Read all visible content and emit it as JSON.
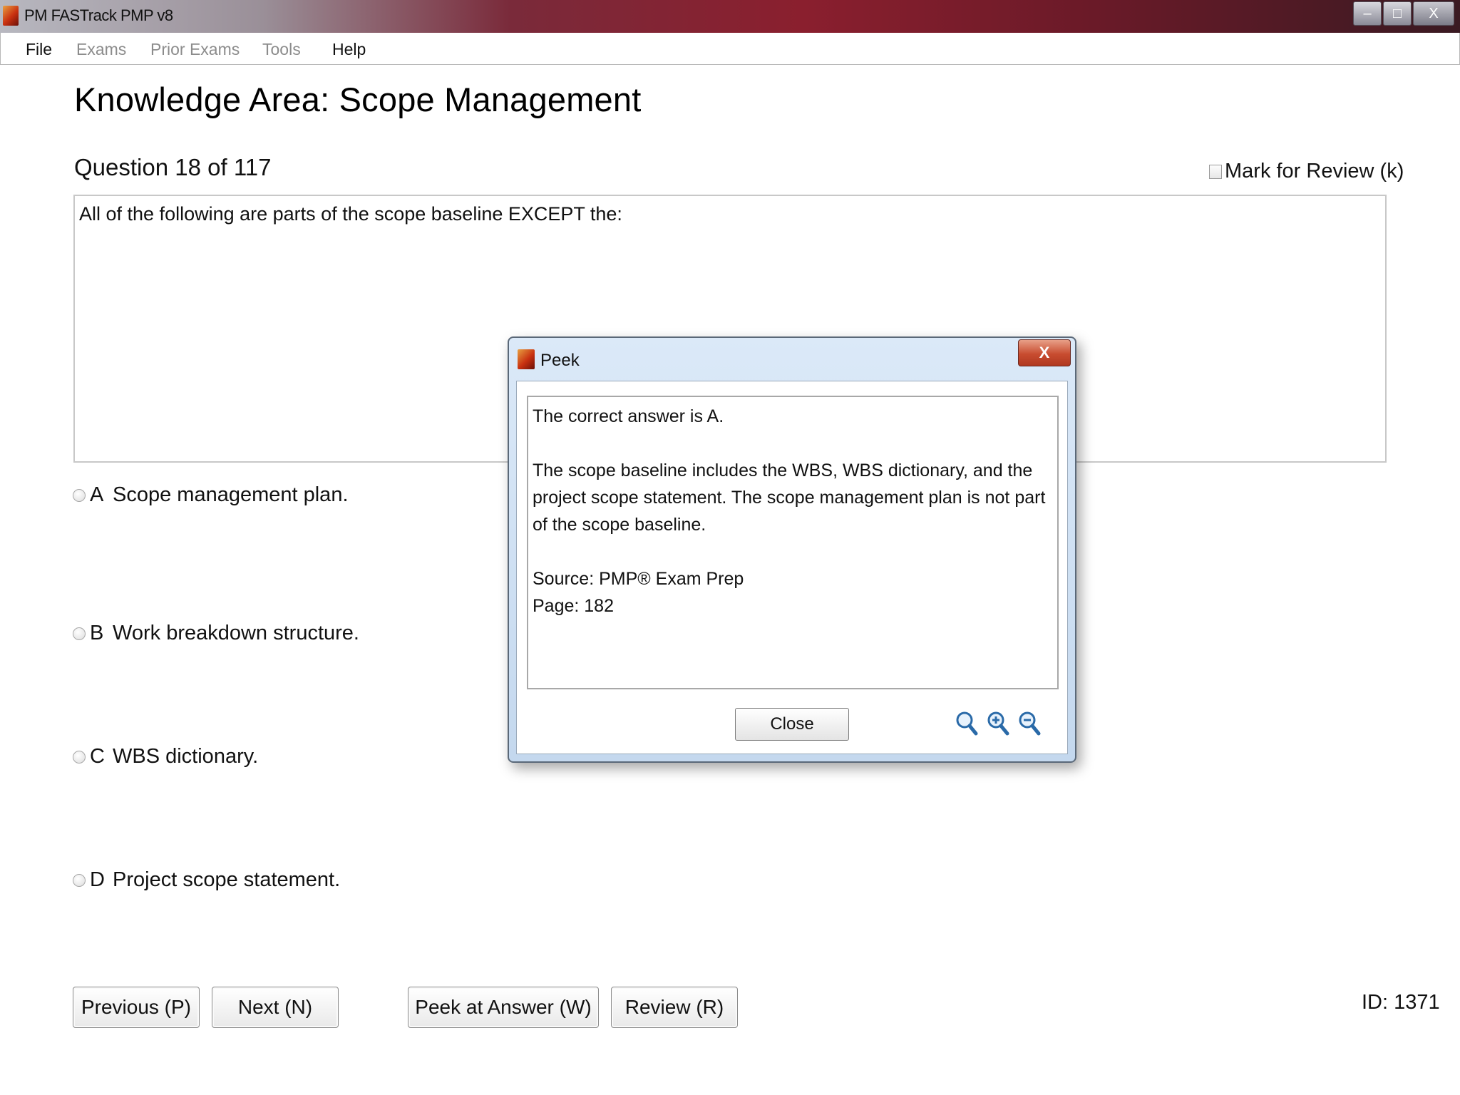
{
  "window": {
    "title": "PM FASTrack PMP v8",
    "controls": {
      "minimize": "–",
      "restore": "□",
      "close": "X"
    }
  },
  "menu": {
    "file": "File",
    "exams": "Exams",
    "prior_exams": "Prior Exams",
    "tools": "Tools",
    "help": "Help"
  },
  "main": {
    "heading": "Knowledge Area: Scope Management",
    "question_number": "Question 18 of 117",
    "mark_for_review": "Mark for Review (k)",
    "question_text": "All of the following are parts of the scope baseline EXCEPT the:",
    "options": [
      {
        "letter": "A",
        "text": "Scope management plan."
      },
      {
        "letter": "B",
        "text": "Work breakdown structure."
      },
      {
        "letter": "C",
        "text": "WBS dictionary."
      },
      {
        "letter": "D",
        "text": "Project scope statement."
      }
    ]
  },
  "buttons": {
    "previous": "Previous (P)",
    "next": "Next (N)",
    "peek": "Peek at Answer (W)",
    "review": "Review (R)"
  },
  "id_label": "ID: 1371",
  "dialog": {
    "title": "Peek",
    "close_x": "X",
    "line1": "The correct answer is A.",
    "line2": "The scope baseline includes the WBS, WBS dictionary, and the project scope statement. The scope management plan is not part of the scope baseline.",
    "line3": "Source: PMP® Exam Prep",
    "line4": "Page: 182",
    "close_button": "Close",
    "zoom_icons": [
      "zoom-reset-icon",
      "zoom-in-icon",
      "zoom-out-icon"
    ]
  },
  "colors": {
    "dialog_frame": "#c4d8ee",
    "close_red": "#c84c30"
  }
}
